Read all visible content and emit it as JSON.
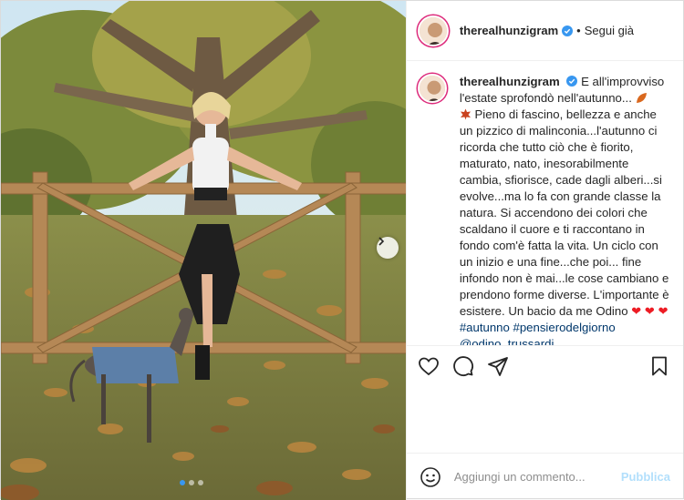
{
  "post": {
    "username": "therealhunzigram",
    "follow_separator": "•",
    "follow_label": "Segui già",
    "caption": {
      "username": "therealhunzigram",
      "text_1": "E all'improvviso l'estate sprofondò nell'autunno...",
      "text_2": "Pieno di fascino, bellezza e anche un pizzico di malinconia...l'autunno ci ricorda che tutto ciò che è fiorito, maturato, nato, inesorabilmente cambia, sfiorisce, cade dagli alberi...si evolve...ma lo fa con grande classe la natura. Si accendono dei colori che scaldano il cuore e ti raccontano in fondo com'è fatta la vita. Un ciclo con un inizio e una fine...che poi... fine infondo non è mai...le cose cambiano e prendono forme diverse. L'importante è esistere. Un bacio da me Odino",
      "hearts": "❤ ❤ ❤",
      "hashtag_1": "#autunno",
      "hashtag_2": "#pensierodelgiorno",
      "mention": "@odino_trussardi"
    },
    "comment_placeholder": "Aggiungi un commento...",
    "publish_label": "Pubblica"
  },
  "icons": [
    "verified-badge-icon",
    "leaf-icon",
    "heart-icon",
    "comment-icon",
    "share-icon",
    "save-icon",
    "emoji-icon",
    "chevron-right-icon"
  ],
  "colors": {
    "verified": "#3897f0",
    "link": "#00376b",
    "publish_disabled": "#b2dffc",
    "active_dot": "#3897f0"
  }
}
